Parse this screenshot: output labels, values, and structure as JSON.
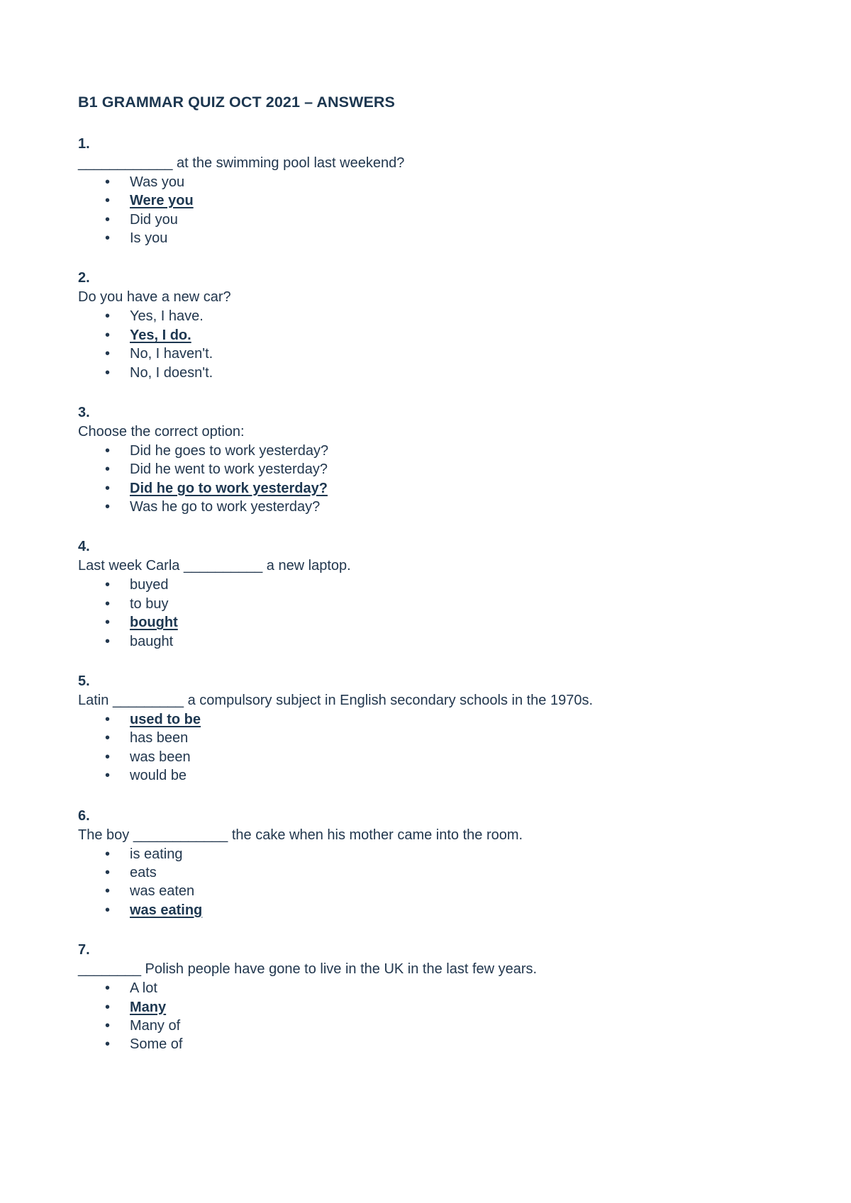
{
  "document": {
    "title": "B1 GRAMMAR QUIZ OCT 2021 – ANSWERS",
    "text_color": "#22374e",
    "background_color": "#ffffff",
    "bullet_glyph": "•"
  },
  "questions": [
    {
      "number": "1.",
      "prompt_before_blank": "",
      "blank": "____________",
      "prompt_after_blank": " at the swimming pool last weekend?",
      "options": [
        {
          "text": "Was you",
          "correct": false
        },
        {
          "text": "Were you",
          "correct": true
        },
        {
          "text": "Did you",
          "correct": false
        },
        {
          "text": "Is you",
          "correct": false
        }
      ]
    },
    {
      "number": "2.",
      "prompt_before_blank": "Do you have a new car?",
      "blank": "",
      "prompt_after_blank": "",
      "options": [
        {
          "text": "Yes, I have.",
          "correct": false
        },
        {
          "text": "Yes, I do.",
          "correct": true
        },
        {
          "text": "No, I haven't.",
          "correct": false
        },
        {
          "text": "No, I doesn't.",
          "correct": false
        }
      ]
    },
    {
      "number": "3.",
      "prompt_before_blank": "Choose the correct option:",
      "blank": "",
      "prompt_after_blank": "",
      "options": [
        {
          "text": "Did he goes to work yesterday?",
          "correct": false
        },
        {
          "text": "Did he went to work yesterday?",
          "correct": false
        },
        {
          "text": "Did he go to work yesterday?",
          "correct": true
        },
        {
          "text": "Was he go to work yesterday?",
          "correct": false
        }
      ]
    },
    {
      "number": "4.",
      "prompt_before_blank": "Last week Carla ",
      "blank": "__________",
      "prompt_after_blank": " a new laptop.",
      "options": [
        {
          "text": "buyed",
          "correct": false
        },
        {
          "text": "to buy",
          "correct": false
        },
        {
          "text": "bought",
          "correct": true
        },
        {
          "text": "baught",
          "correct": false
        }
      ]
    },
    {
      "number": "5.",
      "prompt_before_blank": "Latin ",
      "blank": "_________",
      "prompt_after_blank": " a compulsory subject in English secondary schools in the 1970s.",
      "options": [
        {
          "text": "used to be",
          "correct": true
        },
        {
          "text": "has been",
          "correct": false
        },
        {
          "text": "was been",
          "correct": false
        },
        {
          "text": "would be",
          "correct": false
        }
      ]
    },
    {
      "number": "6.",
      "prompt_before_blank": "The boy ",
      "blank": "____________",
      "prompt_after_blank": " the cake when his mother came into the room.",
      "options": [
        {
          "text": "is eating",
          "correct": false
        },
        {
          "text": "eats",
          "correct": false
        },
        {
          "text": "was eaten",
          "correct": false
        },
        {
          "text": "was eating",
          "correct": true
        }
      ]
    },
    {
      "number": "7.",
      "prompt_before_blank": "",
      "blank": "________",
      "prompt_after_blank": " Polish people have gone to live in the UK in the last few years.",
      "options": [
        {
          "text": "A lot",
          "correct": false
        },
        {
          "text": "Many",
          "correct": true
        },
        {
          "text": "Many of",
          "correct": false
        },
        {
          "text": "Some of",
          "correct": false
        }
      ]
    }
  ]
}
